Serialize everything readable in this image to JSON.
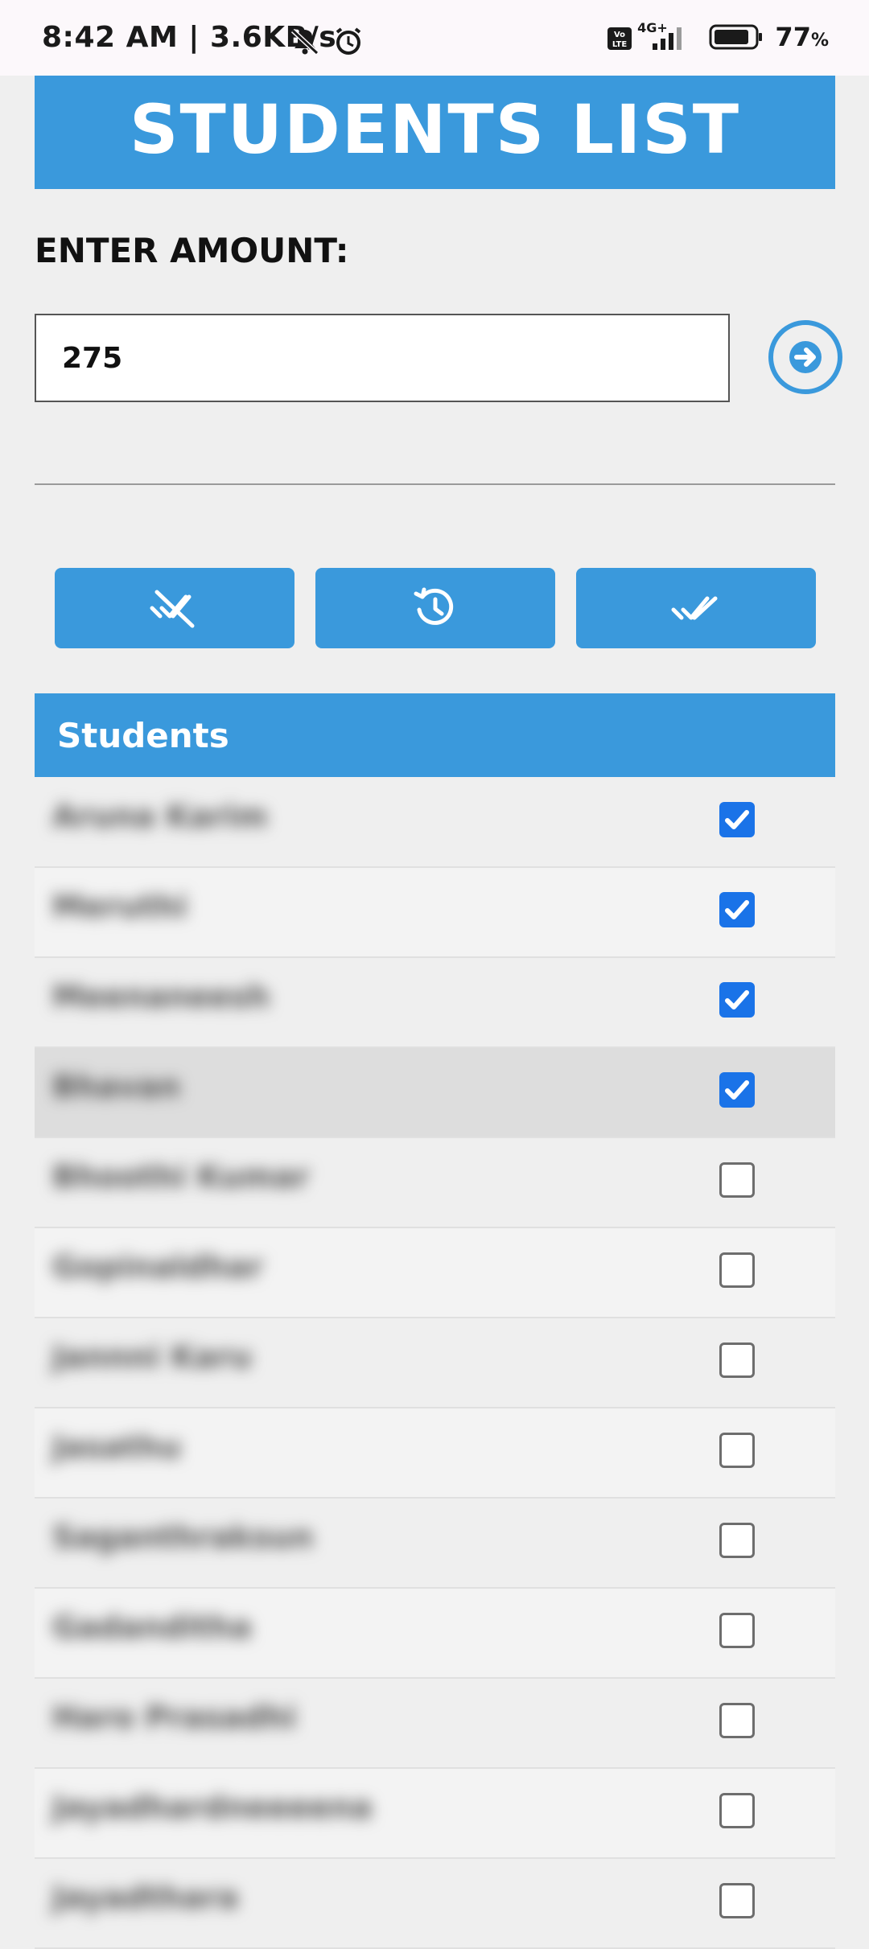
{
  "status_bar": {
    "time_speed": "8:42 AM | 3.6KB/s",
    "network": "4G+",
    "battery": "77",
    "battery_unit": "%"
  },
  "header": {
    "title": "STUDENTS LIST"
  },
  "amount": {
    "label": "ENTER AMOUNT:",
    "value": "275"
  },
  "actions": {
    "clear_icon": "clear-all-icon",
    "history_icon": "history-icon",
    "select_all_icon": "done-all-icon"
  },
  "table": {
    "header": "Students",
    "rows": [
      {
        "name": "Aruna Karim",
        "checked": true
      },
      {
        "name": "Meruthi",
        "checked": true
      },
      {
        "name": "Meenaneesh",
        "checked": true
      },
      {
        "name": "Bhavan",
        "checked": true
      },
      {
        "name": "Bhoothi Kumar",
        "checked": false
      },
      {
        "name": "Gopinaldhar",
        "checked": false
      },
      {
        "name": "Jannni Karu",
        "checked": false
      },
      {
        "name": "Jasathu",
        "checked": false
      },
      {
        "name": "Saganthraksun",
        "checked": false
      },
      {
        "name": "Gadanditha",
        "checked": false
      },
      {
        "name": "Haro Prasadhi",
        "checked": false
      },
      {
        "name": "Jayadhardneeeena",
        "checked": false
      },
      {
        "name": "Jayadthara",
        "checked": false
      }
    ]
  },
  "colors": {
    "primary": "#3a99dc",
    "checkbox": "#1a73e8",
    "background": "#efefef"
  }
}
